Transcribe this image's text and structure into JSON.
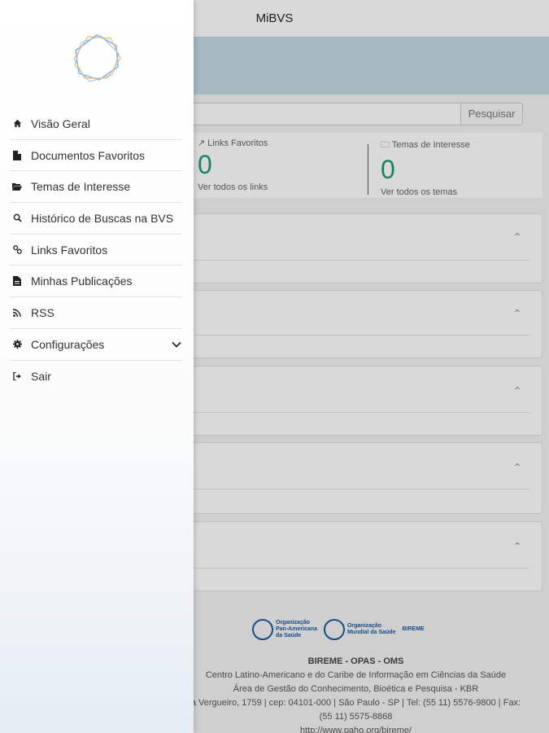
{
  "app": {
    "title": "MiBVS"
  },
  "search": {
    "button_label": "Pesquisar"
  },
  "stats": [
    {
      "label": "Links Favoritos",
      "value": "0",
      "link": "Ver todos os links"
    },
    {
      "label": "Temas de Interesse",
      "value": "0",
      "link": "Ver todos os temas"
    }
  ],
  "footer": {
    "logos": [
      {
        "line1": "Organização",
        "line2": "Pan-Americana",
        "line3": "da Saúde"
      },
      {
        "line1": "Organização",
        "line2": "Mundial da Saúde",
        "line3": ""
      },
      {
        "line1": "BIREME",
        "line2": "",
        "line3": ""
      }
    ],
    "org": "BIREME - OPAS - OMS",
    "line1": "Centro Latino-Americano e do Caribe de Informação em Ciências da Saúde",
    "line2": "Área de Gestão do Conhecimento, Bioética e Pesquisa - KBR",
    "line3": "a Vergueiro, 1759 | cep: 04101-000 | São Paulo - SP | Tel: (55 11) 5576-9800 | Fax:",
    "line4": "(55 11) 5575-8868",
    "line5": "http://www.paho.org/bireme/"
  },
  "drawer": {
    "logo_colors": {
      "primary": "#7aaee0",
      "secondary": "#f0b870"
    },
    "menu": [
      {
        "label": "Visão Geral",
        "icon": "home-icon"
      },
      {
        "label": "Documentos Favoritos",
        "icon": "document-icon"
      },
      {
        "label": "Temas de Interesse",
        "icon": "folder-open-icon"
      },
      {
        "label": "Histórico de Buscas na BVS",
        "icon": "search-icon"
      },
      {
        "label": "Links Favoritos",
        "icon": "link-icon"
      },
      {
        "label": "Minhas Publicações",
        "icon": "file-icon"
      },
      {
        "label": "RSS",
        "icon": "rss-icon"
      },
      {
        "label": "Configurações",
        "icon": "gear-icon",
        "expandable": true
      },
      {
        "label": "Sair",
        "icon": "sign-out-icon"
      }
    ]
  },
  "colors": {
    "accent": "#1a9a7a",
    "banner": "#c4dbe6"
  }
}
